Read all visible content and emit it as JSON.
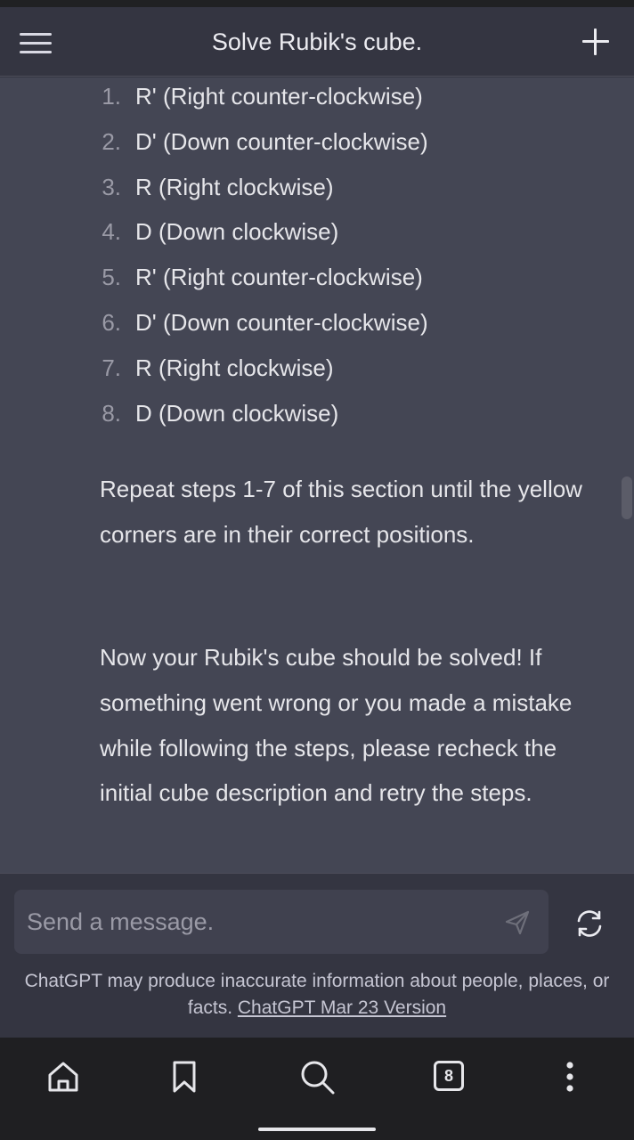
{
  "header": {
    "title": "Solve Rubik's cube."
  },
  "steps": [
    {
      "num": "1.",
      "text": "R' (Right counter-clockwise)"
    },
    {
      "num": "2.",
      "text": "D' (Down counter-clockwise)"
    },
    {
      "num": "3.",
      "text": "R (Right clockwise)"
    },
    {
      "num": "4.",
      "text": "D (Down clockwise)"
    },
    {
      "num": "5.",
      "text": "R' (Right counter-clockwise)"
    },
    {
      "num": "6.",
      "text": "D' (Down counter-clockwise)"
    },
    {
      "num": "7.",
      "text": "R (Right clockwise)"
    },
    {
      "num": "8.",
      "text": "D (Down clockwise)"
    }
  ],
  "paragraphs": [
    "Repeat steps 1-7 of this section until the yellow corners are in their correct positions.",
    "Now your Rubik's cube should be solved! If something went wrong or you made a mistake while following the steps, please recheck the initial cube description and retry the steps."
  ],
  "composer": {
    "placeholder": "Send a message.",
    "disclaimer": "ChatGPT may produce inaccurate information about people, places, or facts.",
    "version_link": "ChatGPT Mar 23 Version"
  },
  "browser_nav": {
    "tab_count": "8"
  },
  "icons": {
    "menu": "hamburger-menu-icon",
    "new_chat": "plus-icon",
    "scroll_down": "arrow-down-icon",
    "send": "send-icon",
    "regenerate": "refresh-icon",
    "home": "home-icon",
    "bookmarks": "bookmark-icon",
    "search": "search-icon",
    "tabs": "tabs-icon",
    "more": "more-vertical-icon"
  },
  "colors": {
    "background": "#343541",
    "assistant_bg": "#444654",
    "text": "#ececf1",
    "muted": "#9a9aa6",
    "nav_bg": "#1f1f22"
  }
}
